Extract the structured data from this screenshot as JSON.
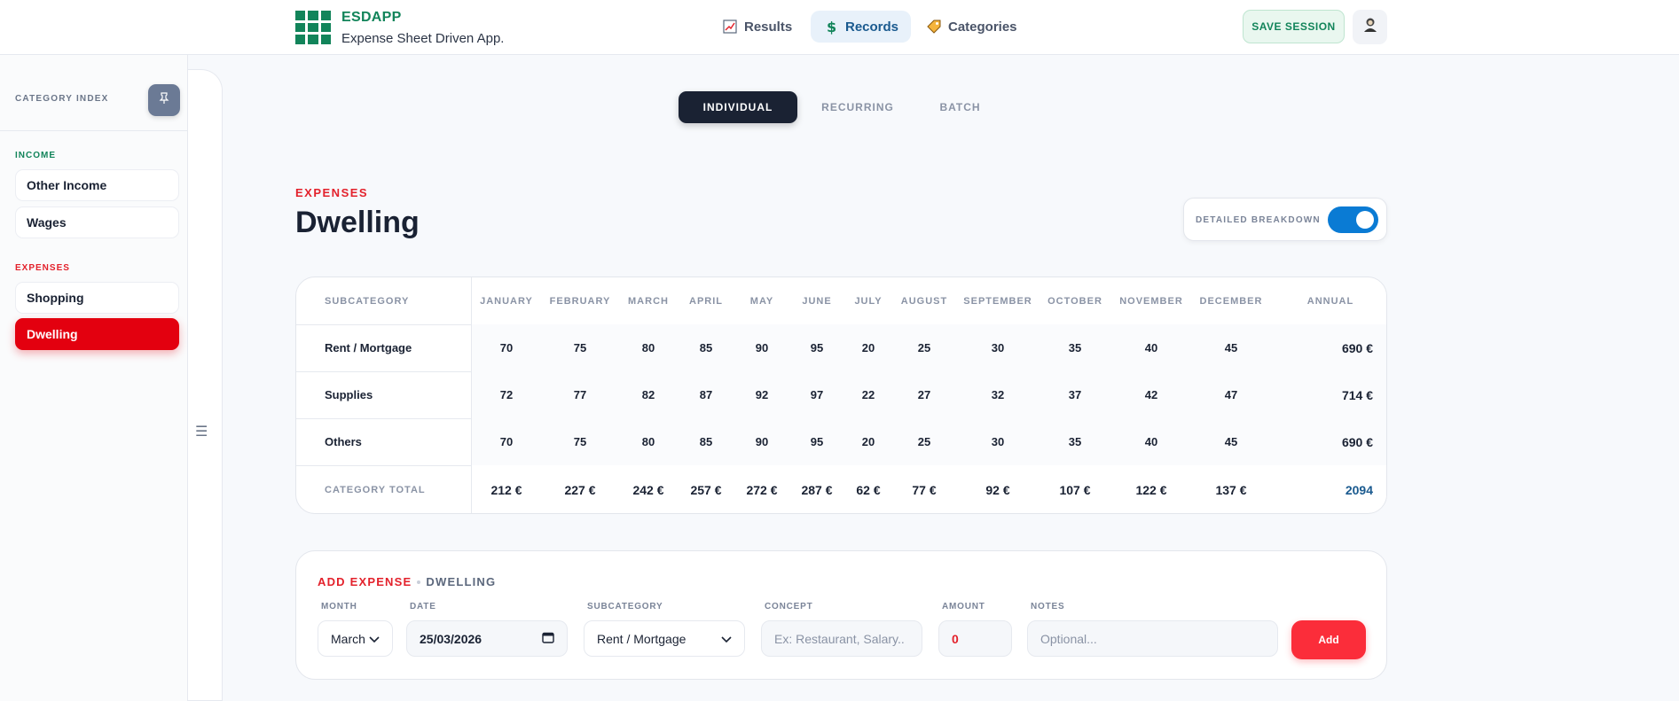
{
  "app": {
    "name": "ESDAPP",
    "tagline": "Expense Sheet Driven App."
  },
  "nav": {
    "items": [
      {
        "label": "Results",
        "icon": "chart-icon",
        "active": false
      },
      {
        "label": "Records",
        "icon": "dollar-icon",
        "active": true
      },
      {
        "label": "Categories",
        "icon": "tag-icon",
        "active": false
      }
    ],
    "save_label": "SAVE SESSION",
    "user_icon": "user-icon"
  },
  "sidebar": {
    "title": "CATEGORY INDEX",
    "pin_icon": "pin-icon",
    "income_label": "INCOME",
    "income_items": [
      "Other Income",
      "Wages"
    ],
    "expenses_label": "EXPENSES",
    "expense_items": [
      "Shopping",
      "Dwelling"
    ],
    "active_item": "Dwelling",
    "collapse_icon": "menu-icon"
  },
  "mode_tabs": [
    {
      "label": "INDIVIDUAL",
      "active": true
    },
    {
      "label": "RECURRING",
      "active": false
    },
    {
      "label": "BATCH",
      "active": false
    }
  ],
  "category": {
    "type": "EXPENSES",
    "title": "Dwelling"
  },
  "breakdown": {
    "label": "DETAILED BREAKDOWN",
    "enabled": true
  },
  "table": {
    "subcategory_header": "SUBCATEGORY",
    "months": [
      "JANUARY",
      "FEBRUARY",
      "MARCH",
      "APRIL",
      "MAY",
      "JUNE",
      "JULY",
      "AUGUST",
      "SEPTEMBER",
      "OCTOBER",
      "NOVEMBER",
      "DECEMBER"
    ],
    "annual_header": "ANNUAL",
    "rows": [
      {
        "name": "Rent / Mortgage",
        "values": [
          "70",
          "75",
          "80",
          "85",
          "90",
          "95",
          "20",
          "25",
          "30",
          "35",
          "40",
          "45"
        ],
        "annual": "690 €"
      },
      {
        "name": "Supplies",
        "values": [
          "72",
          "77",
          "82",
          "87",
          "92",
          "97",
          "22",
          "27",
          "32",
          "37",
          "42",
          "47"
        ],
        "annual": "714 €"
      },
      {
        "name": "Others",
        "values": [
          "70",
          "75",
          "80",
          "85",
          "90",
          "95",
          "20",
          "25",
          "30",
          "35",
          "40",
          "45"
        ],
        "annual": "690 €"
      }
    ],
    "total_label": "CATEGORY TOTAL",
    "totals": [
      "212 €",
      "227 €",
      "242 €",
      "257 €",
      "272 €",
      "287 €",
      "62 €",
      "77 €",
      "92 €",
      "107 €",
      "122 €",
      "137 €"
    ],
    "grand_total": "2094",
    "grand_total_color": "#1a5a8f"
  },
  "add_form": {
    "title": "ADD EXPENSE",
    "category": "DWELLING",
    "month_label": "MONTH",
    "month_value": "March",
    "date_label": "DATE",
    "date_value": "25/03/2026",
    "subcategory_label": "SUBCATEGORY",
    "subcategory_value": "Rent / Mortgage",
    "concept_label": "CONCEPT",
    "concept_placeholder": "Ex: Restaurant, Salary..",
    "amount_label": "AMOUNT",
    "amount_value": "0",
    "notes_label": "NOTES",
    "notes_placeholder": "Optional...",
    "add_label": "Add"
  },
  "colors": {
    "brand_green": "#12845a",
    "expense_red": "#e3000f",
    "toggle_blue": "#0a7bd4",
    "dark": "#1a2233"
  }
}
